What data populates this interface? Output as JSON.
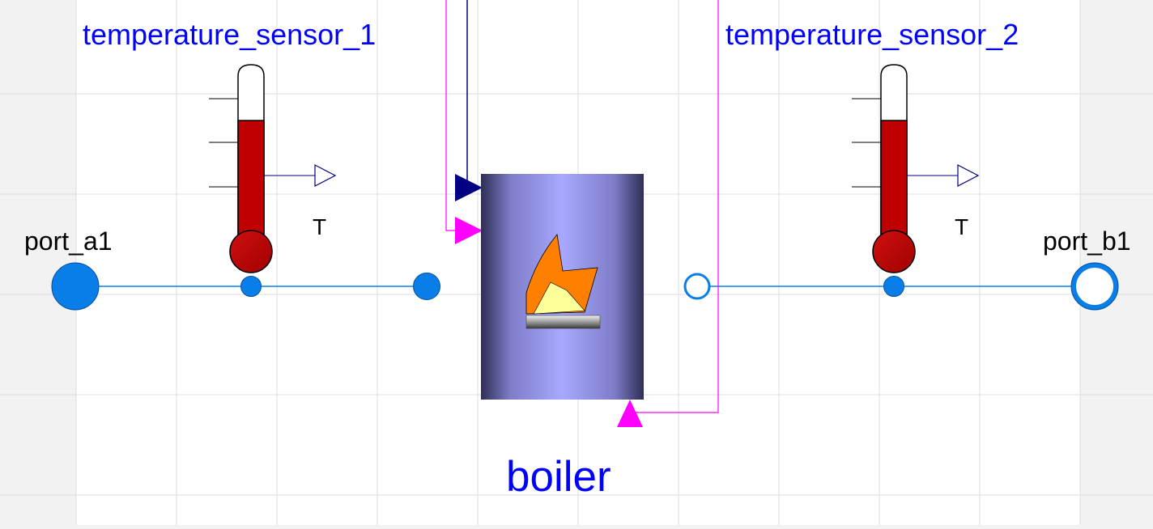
{
  "labels": {
    "sensor_1": "temperature_sensor_1",
    "sensor_2": "temperature_sensor_2",
    "sensor_1_output": "T",
    "sensor_2_output": "T",
    "port_a1": "port_a1",
    "port_b1": "port_b1",
    "boiler": "boiler"
  },
  "colors": {
    "component_name": "#0000ff",
    "fluid_connection": "#0a7ee8",
    "control_connection": "#ff00ff",
    "boolean_connection": "#000080",
    "thermometer_fill": "#c00000",
    "boiler_body": "#a6a6ff",
    "flame_outer": "#ff8000",
    "flame_inner": "#ffff99",
    "grid": "#dcdcdc",
    "diagram_background": "#ffffff"
  },
  "icons": [
    "thermometer-icon",
    "flame-icon",
    "burner-icon",
    "fluid-port-icon",
    "signal-arrow-icon"
  ]
}
